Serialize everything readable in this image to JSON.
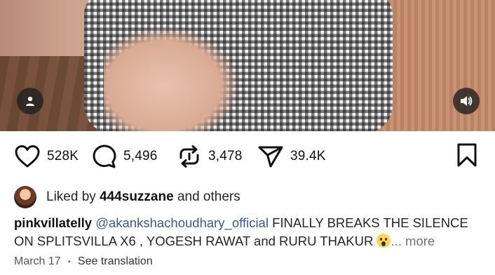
{
  "actions": {
    "likes": "528K",
    "comments": "5,496",
    "reposts": "3,478",
    "shares": "39.4K"
  },
  "liked_by": {
    "prefix": "Liked by ",
    "user": "444suzzane",
    "suffix": " and others"
  },
  "caption": {
    "username": "pinkvillatelly",
    "mention": "@akankshachoudhary_official",
    "text": " FINALLY BREAKS THE SILENCE ON SPLITSVILLA X6 , YOGESH RAWAT and RURU THAKUR ",
    "more": "... more"
  },
  "meta": {
    "date": "March 17",
    "separator": "•",
    "translate": "See translation"
  },
  "icons": {
    "user": "person-icon",
    "sound": "speaker-icon",
    "like": "heart-icon",
    "comment": "comment-bubble-icon",
    "repost": "repost-icon",
    "share": "send-icon",
    "save": "bookmark-icon",
    "emoji": "face-screaming-emoji"
  }
}
